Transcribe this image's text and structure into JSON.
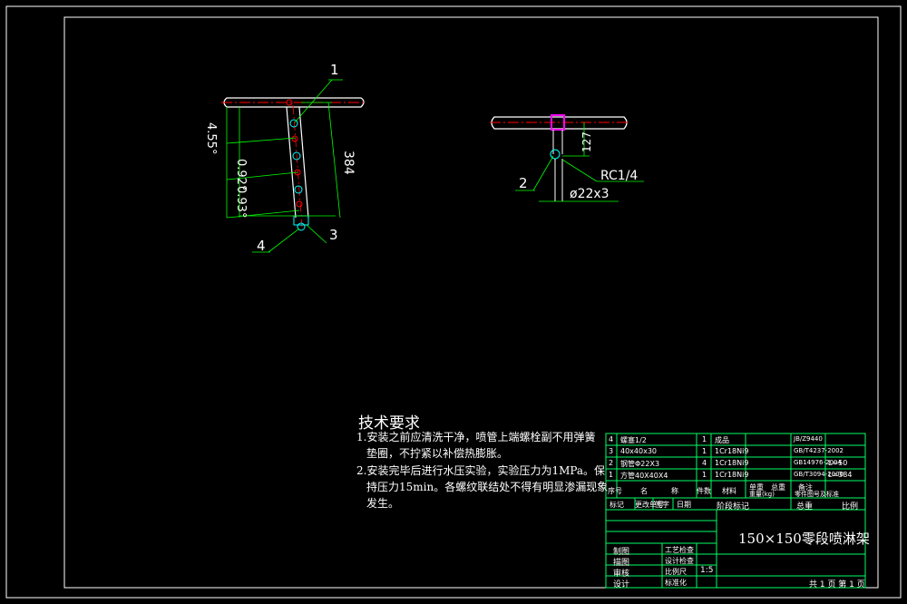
{
  "drawing": {
    "colors": {
      "background": "#000000",
      "frame": "#ffffff",
      "pipe": "#ffffff",
      "dimension": "#00ff00",
      "centerline": "#ff0000",
      "nozzle": "#00ffff",
      "highlight": "#ff00ff",
      "table_lines": "#00ff66"
    },
    "left_view": {
      "balloons": [
        "1",
        "3",
        "4"
      ],
      "angle_dims": [
        "4.55°",
        "0.92°",
        "0.93°"
      ],
      "length_dim": "384"
    },
    "right_view": {
      "balloon": "2",
      "height_dim": "127",
      "thread_label": "RC1/4",
      "hole_label": "ø22x3"
    },
    "tech_requirements": {
      "title": "技术要求",
      "notes": [
        "1.安装之前应清洗干净，喷管上端螺栓副不用弹簧",
        "垫圈，不拧紧以补偿热膨胀。",
        "2.安装完毕后进行水压实验，实验压力为1MPa。保",
        "持压力15min。各螺纹联结处不得有明显渗漏现象",
        "发生。"
      ]
    },
    "parts_list": {
      "rows": [
        {
          "no": "4",
          "name": "螺塞1/2",
          "qty": "1",
          "material": "成品",
          "std": "JB/Z9440",
          "note": ""
        },
        {
          "no": "3",
          "name": "40x40x30",
          "qty": "1",
          "material": "1Cr18Ni9",
          "std": "GB/T4237-2002",
          "note": ""
        },
        {
          "no": "2",
          "name": "钢管Φ22X3",
          "qty": "4",
          "material": "1Cr18Ni9",
          "std": "GB14976-2004",
          "note": "L=50"
        },
        {
          "no": "1",
          "name": "方管40X40X4",
          "qty": "1",
          "material": "1Cr18Ni9",
          "std": "GB/T3094-2000",
          "note": "L=384"
        }
      ],
      "header": [
        "序号",
        "名",
        "称",
        "件数",
        "材料",
        "单重",
        "总重",
        "备注"
      ],
      "header2": [
        "零件图号及标准",
        "重量(kg)"
      ],
      "sig_head": [
        "标记",
        "更改单号",
        "签字",
        "日期"
      ],
      "title_block": {
        "label_assembly": "阶段标记",
        "label_weight": "总重",
        "label_ratio": "比例",
        "drawing_name": "150×150零段喷淋架",
        "scale": "1:5",
        "sheet": "共 1 页 第 1 页",
        "roles": [
          "制图",
          "描图",
          "审核",
          "设计"
        ],
        "mid_labels": [
          "工艺检查",
          "设计检查",
          "比例尺",
          "标准化"
        ]
      }
    }
  }
}
